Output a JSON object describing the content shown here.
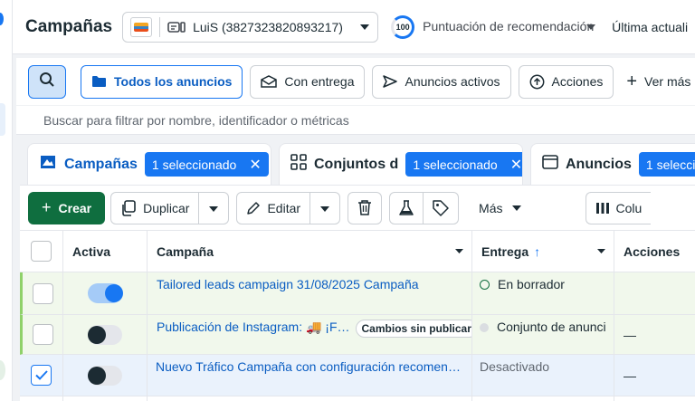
{
  "header": {
    "title": "Campañas",
    "account_name": "LuiS (3827323820893217)",
    "score_value": "100",
    "score_label": "Puntuación de recomendación",
    "last_update": "Última actuali"
  },
  "filters": {
    "all_ads": "Todos los anuncios",
    "with_delivery": "Con entrega",
    "active_ads": "Anuncios activos",
    "actions": "Acciones",
    "see_more": "Ver más",
    "search_placeholder": "Buscar para filtrar por nombre, identificador o métricas"
  },
  "tabs": [
    {
      "label": "Campañas",
      "badge": "1 seleccionado"
    },
    {
      "label": "Conjuntos d",
      "badge": "1 seleccionado"
    },
    {
      "label": "Anuncios",
      "badge": "1 selecció"
    }
  ],
  "toolbar": {
    "create": "Crear",
    "duplicate": "Duplicar",
    "edit": "Editar",
    "more": "Más",
    "columns": "Colu"
  },
  "table": {
    "headers": {
      "active": "Activa",
      "campaign": "Campaña",
      "delivery": "Entrega",
      "actions": "Acciones"
    },
    "rows": [
      {
        "name": "Tailored leads campaign 31/08/2025 Campaña",
        "delivery": "En borrador",
        "actions": "",
        "active": true,
        "checked": false
      },
      {
        "name": "Publicación de Instagram: 🚚 ¡F…",
        "pill": "Cambios sin publicar",
        "delivery": "Conjunto de anunci",
        "actions": "—",
        "active": false,
        "checked": false
      },
      {
        "name": "Nuevo Tráfico Campaña con configuración recomen…",
        "delivery": "Desactivado",
        "actions": "—",
        "active": false,
        "checked": true
      }
    ]
  },
  "colors": {
    "brand_blue": "#1877f2",
    "create_green": "#0f6e3f",
    "row_tint_green": "#f1f8ec",
    "row_tint_blue": "#eaf2fc",
    "row_edge_green": "#8fd16a"
  }
}
